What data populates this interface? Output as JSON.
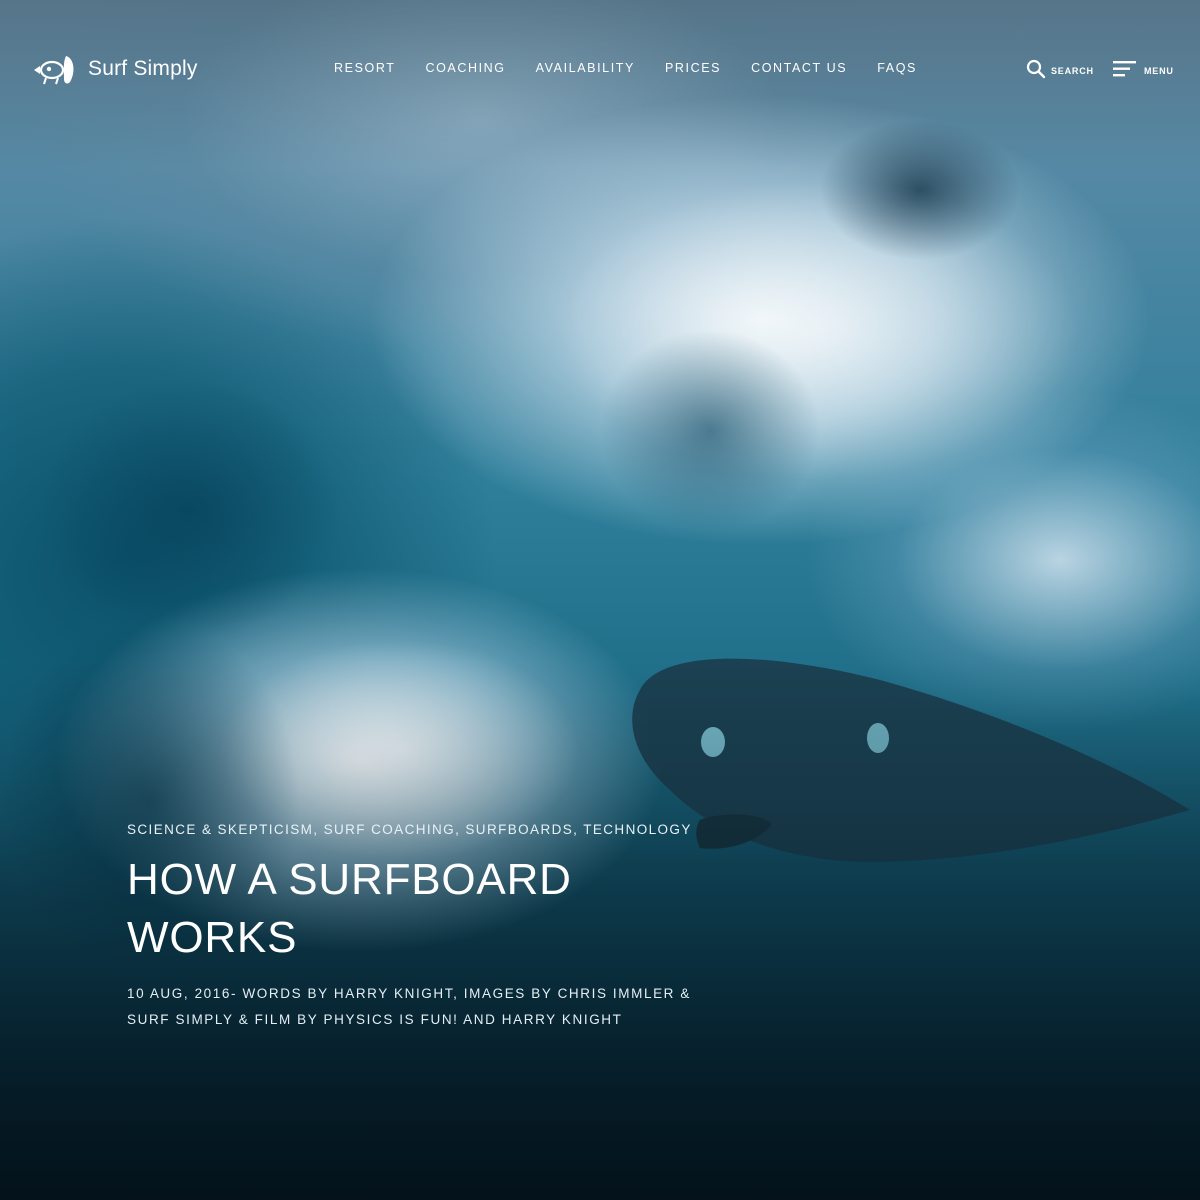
{
  "brand": {
    "name": "Surf Simply"
  },
  "nav": {
    "items": [
      {
        "label": "RESORT"
      },
      {
        "label": "COACHING"
      },
      {
        "label": "AVAILABILITY"
      },
      {
        "label": "PRICES"
      },
      {
        "label": "CONTACT US"
      },
      {
        "label": "FAQS"
      }
    ]
  },
  "utility": {
    "search_label": "SEARCH",
    "search_icon": "search-icon",
    "menu_label": "MENU",
    "menu_icon": "hamburger-icon"
  },
  "article": {
    "categories": [
      {
        "label": "SCIENCE & SKEPTICISM"
      },
      {
        "label": "SURF COACHING"
      },
      {
        "label": "SURFBOARDS"
      },
      {
        "label": "TECHNOLOGY"
      }
    ],
    "category_separator": ", ",
    "title": "HOW A SURFBOARD WORKS",
    "byline": "10 AUG, 2016- WORDS BY HARRY KNIGHT, IMAGES BY CHRIS IMMLER & SURF SIMPLY & FILM BY PHYSICS IS FUN! AND HARRY KNIGHT"
  },
  "colors": {
    "text": "#ffffff",
    "water_deep": "#0b3445",
    "water_mid": "#1f6e88",
    "foam": "#eef5f9"
  }
}
